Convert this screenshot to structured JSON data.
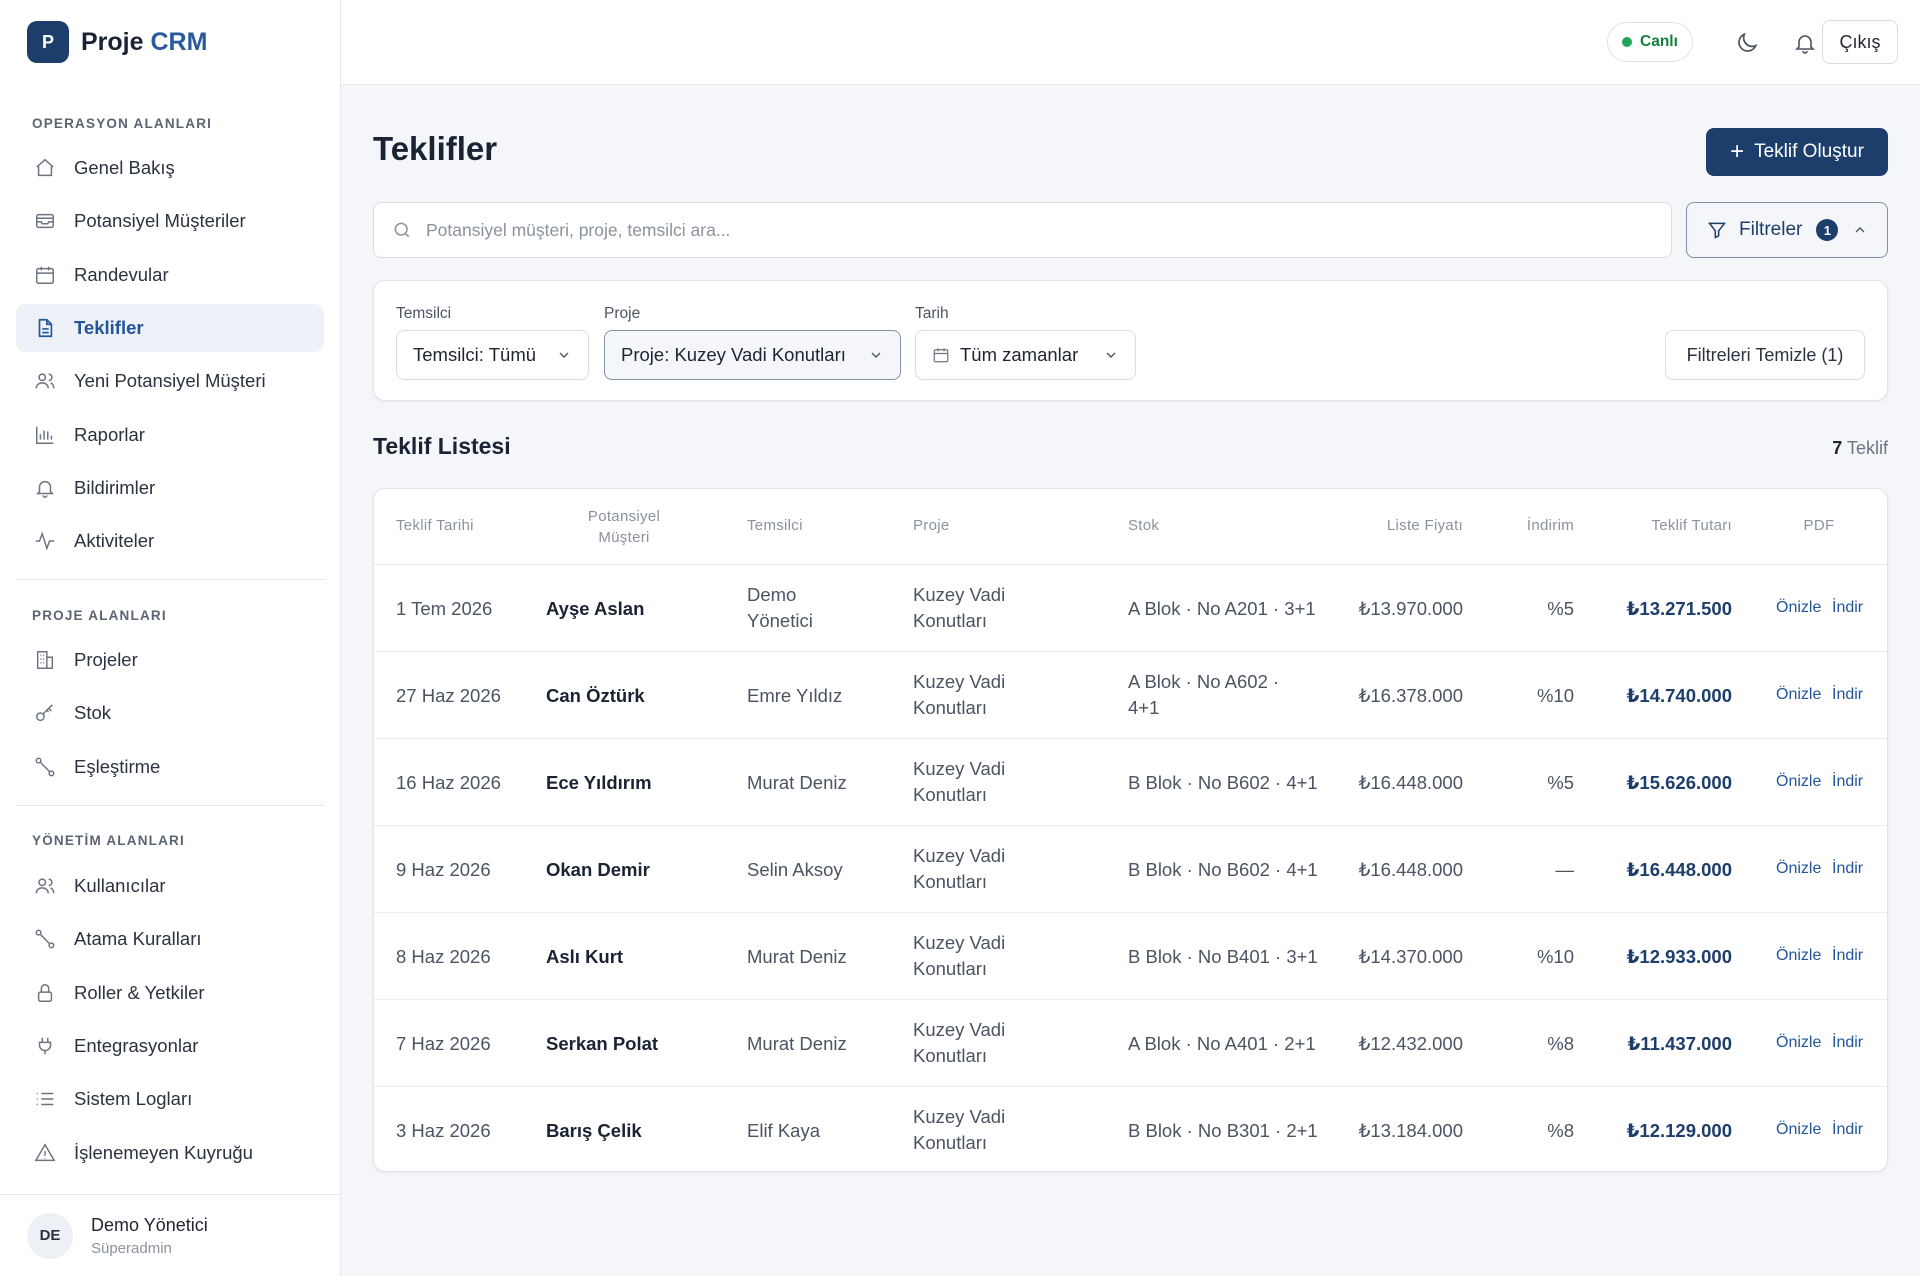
{
  "brand": {
    "logo_letter": "P",
    "name": "Proje",
    "accent": "CRM"
  },
  "sidebar": {
    "section_ops": "OPERASYON ALANLARI",
    "ops_items": [
      {
        "label": "Genel Bakış",
        "icon": "home-icon"
      },
      {
        "label": "Potansiyel Müşteriler",
        "icon": "inbox-icon"
      },
      {
        "label": "Randevular",
        "icon": "calendar-icon"
      },
      {
        "label": "Teklifler",
        "icon": "document-icon",
        "active": true
      },
      {
        "label": "Yeni Potansiyel Müşteri",
        "icon": "users-icon"
      },
      {
        "label": "Raporlar",
        "icon": "bar-chart-icon"
      },
      {
        "label": "Bildirimler",
        "icon": "bell-icon"
      },
      {
        "label": "Aktiviteler",
        "icon": "activity-icon"
      }
    ],
    "section_project": "PROJE ALANLARI",
    "project_items": [
      {
        "label": "Projeler",
        "icon": "building-icon"
      },
      {
        "label": "Stok",
        "icon": "key-icon"
      },
      {
        "label": "Eşleştirme",
        "icon": "route-icon"
      }
    ],
    "section_admin": "YÖNETİM ALANLARI",
    "admin_items": [
      {
        "label": "Kullanıcılar",
        "icon": "users-icon"
      },
      {
        "label": "Atama Kuralları",
        "icon": "route-icon"
      },
      {
        "label": "Roller & Yetkiler",
        "icon": "lock-icon"
      },
      {
        "label": "Entegrasyonlar",
        "icon": "plug-icon"
      },
      {
        "label": "Sistem Logları",
        "icon": "list-icon"
      },
      {
        "label": "İşlenemeyen Kuyruğu",
        "icon": "warning-icon"
      }
    ],
    "user": {
      "initials": "DE",
      "name": "Demo Yönetici",
      "role": "Süperadmin"
    }
  },
  "topbar": {
    "live_label": "Canlı",
    "logout_label": "Çıkış"
  },
  "page": {
    "title": "Teklifler",
    "create_button": "Teklif Oluştur",
    "search_placeholder": "Potansiyel müşteri, proje, temsilci ara...",
    "filters_label": "Filtreler",
    "filters_count": "1"
  },
  "filters": {
    "rep_label": "Temsilci",
    "rep_value": "Temsilci: Tümü",
    "project_label": "Proje",
    "project_value": "Proje: Kuzey Vadi Konutları",
    "date_label": "Tarih",
    "date_value": "Tüm zamanlar",
    "clear_button": "Filtreleri Temizle (1)"
  },
  "list": {
    "title": "Teklif Listesi",
    "count": "7",
    "count_suffix": "Teklif",
    "columns": [
      "Teklif Tarihi",
      "Potansiyel",
      "Müşteri",
      "Temsilci",
      "Proje",
      "Stok",
      "Liste Fiyatı",
      "İndirim",
      "Teklif Tutarı",
      "PDF"
    ],
    "preview_label": "Önizle",
    "download_label": "İndir",
    "rows": [
      {
        "date": "1 Tem 2026",
        "customer": "Ayşe Aslan",
        "rep1": "Demo",
        "rep2": "Yönetici",
        "project1": "Kuzey Vadi",
        "project2": "Konutları",
        "stock1": "A Blok · No A201 · 3+1",
        "stock2": "",
        "price": "₺13.970.000",
        "discount": "%5",
        "amount": "₺13.271.500"
      },
      {
        "date": "27 Haz 2026",
        "customer": "Can Öztürk",
        "rep1": "Emre Yıldız",
        "rep2": "",
        "project1": "Kuzey Vadi",
        "project2": "Konutları",
        "stock1": "A Blok · No A602 ·",
        "stock2": "4+1",
        "price": "₺16.378.000",
        "discount": "%10",
        "amount": "₺14.740.000"
      },
      {
        "date": "16 Haz 2026",
        "customer": "Ece Yıldırım",
        "rep1": "Murat Deniz",
        "rep2": "",
        "project1": "Kuzey Vadi",
        "project2": "Konutları",
        "stock1": "B Blok · No B602 · 4+1",
        "stock2": "",
        "price": "₺16.448.000",
        "discount": "%5",
        "amount": "₺15.626.000"
      },
      {
        "date": "9 Haz 2026",
        "customer": "Okan Demir",
        "rep1": "Selin Aksoy",
        "rep2": "",
        "project1": "Kuzey Vadi",
        "project2": "Konutları",
        "stock1": "B Blok · No B602 · 4+1",
        "stock2": "",
        "price": "₺16.448.000",
        "discount": "—",
        "amount": "₺16.448.000"
      },
      {
        "date": "8 Haz 2026",
        "customer": "Aslı Kurt",
        "rep1": "Murat Deniz",
        "rep2": "",
        "project1": "Kuzey Vadi",
        "project2": "Konutları",
        "stock1": "B Blok · No B401 · 3+1",
        "stock2": "",
        "price": "₺14.370.000",
        "discount": "%10",
        "amount": "₺12.933.000"
      },
      {
        "date": "7 Haz 2026",
        "customer": "Serkan Polat",
        "rep1": "Murat Deniz",
        "rep2": "",
        "project1": "Kuzey Vadi",
        "project2": "Konutları",
        "stock1": "A Blok · No A401 · 2+1",
        "stock2": "",
        "price": "₺12.432.000",
        "discount": "%8",
        "amount": "₺11.437.000"
      },
      {
        "date": "3 Haz 2026",
        "customer": "Barış Çelik",
        "rep1": "Elif Kaya",
        "rep2": "",
        "project1": "Kuzey Vadi",
        "project2": "Konutları",
        "stock1": "B Blok · No B301 · 2+1",
        "stock2": "",
        "price": "₺13.184.000",
        "discount": "%8",
        "amount": "₺12.129.000"
      }
    ]
  },
  "colors": {
    "brand": "#1d3e6b",
    "accent_link": "#24559b",
    "live_green": "#22a55a"
  }
}
